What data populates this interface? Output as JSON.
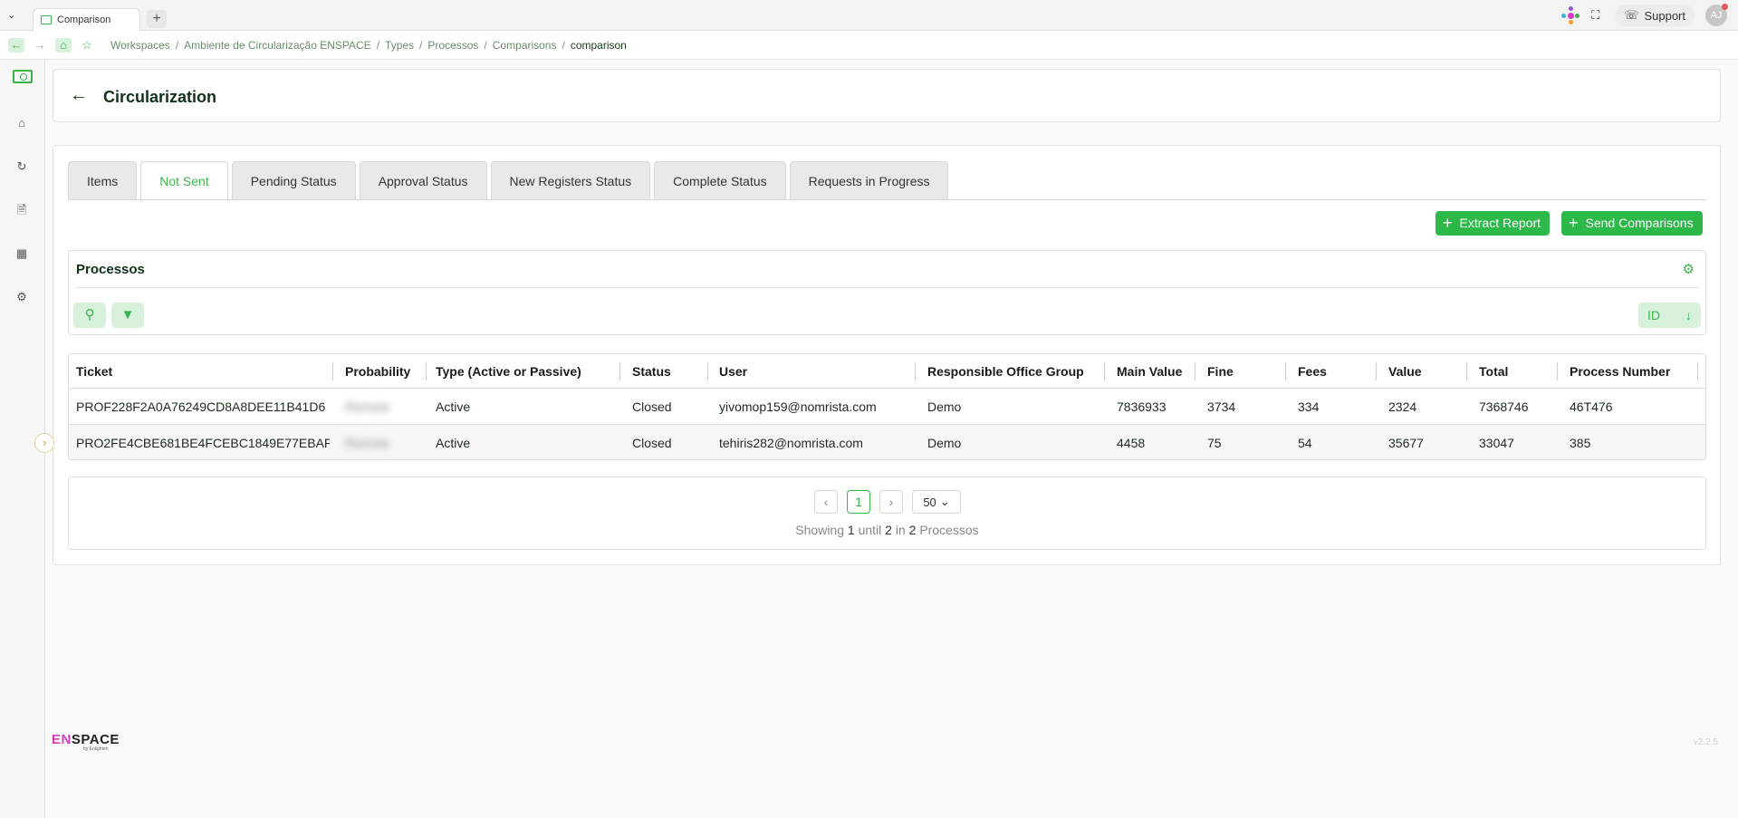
{
  "browser": {
    "tab_title": "Comparison",
    "new_tab": "+",
    "support_label": "Support",
    "avatar_initials": "AJ"
  },
  "breadcrumb": [
    {
      "label": "Workspaces"
    },
    {
      "label": "Ambiente de Circularização ENSPACE"
    },
    {
      "label": "Types"
    },
    {
      "label": "Processos"
    },
    {
      "label": "Comparisons"
    },
    {
      "label": "comparison"
    }
  ],
  "header": {
    "title": "Circularization"
  },
  "tabs": [
    {
      "label": "Items"
    },
    {
      "label": "Not Sent"
    },
    {
      "label": "Pending Status"
    },
    {
      "label": "Approval Status"
    },
    {
      "label": "New Registers Status"
    },
    {
      "label": "Complete Status"
    },
    {
      "label": "Requests in Progress"
    }
  ],
  "active_tab": "Not Sent",
  "actions": {
    "extract_label": "Extract Report",
    "send_label": "Send Comparisons"
  },
  "panel": {
    "title": "Processos",
    "sort_label": "ID"
  },
  "table": {
    "columns": [
      "Ticket",
      "Probability",
      "Type (Active or Passive)",
      "Status",
      "User",
      "Responsible Office Group",
      "Main Value",
      "Fine",
      "Fees",
      "Value",
      "Total",
      "Process Number"
    ],
    "rows": [
      [
        "PROF228F2A0A76249CD8A8DEE11B41D6",
        "Remote",
        "Active",
        "Closed",
        "yivomop159@nomrista.com",
        "Demo",
        "7836933",
        "3734",
        "334",
        "2324",
        "7368746",
        "46T476"
      ],
      [
        "PRO2FE4CBE681BE4FCEBC1849E77EBAF",
        "Remote",
        "Active",
        "Closed",
        "tehiris282@nomrista.com",
        "Demo",
        "4458",
        "75",
        "54",
        "35677",
        "33047",
        "385"
      ]
    ]
  },
  "pagination": {
    "current_page": "1",
    "page_size": "50",
    "info_prefix": "Showing",
    "info_from": "1",
    "info_mid": "until",
    "info_to": "2",
    "info_in": "in",
    "info_total": "2",
    "info_suffix": "Processos"
  },
  "footer": {
    "brand_en": "EN",
    "brand_space": "SPACE",
    "brand_sub": "by Enlighten",
    "version": "v2.2.5"
  },
  "colors": {
    "accent": "#39b54a",
    "button_bg": "#2db84a",
    "brand_magenta": "#d63cc3"
  }
}
